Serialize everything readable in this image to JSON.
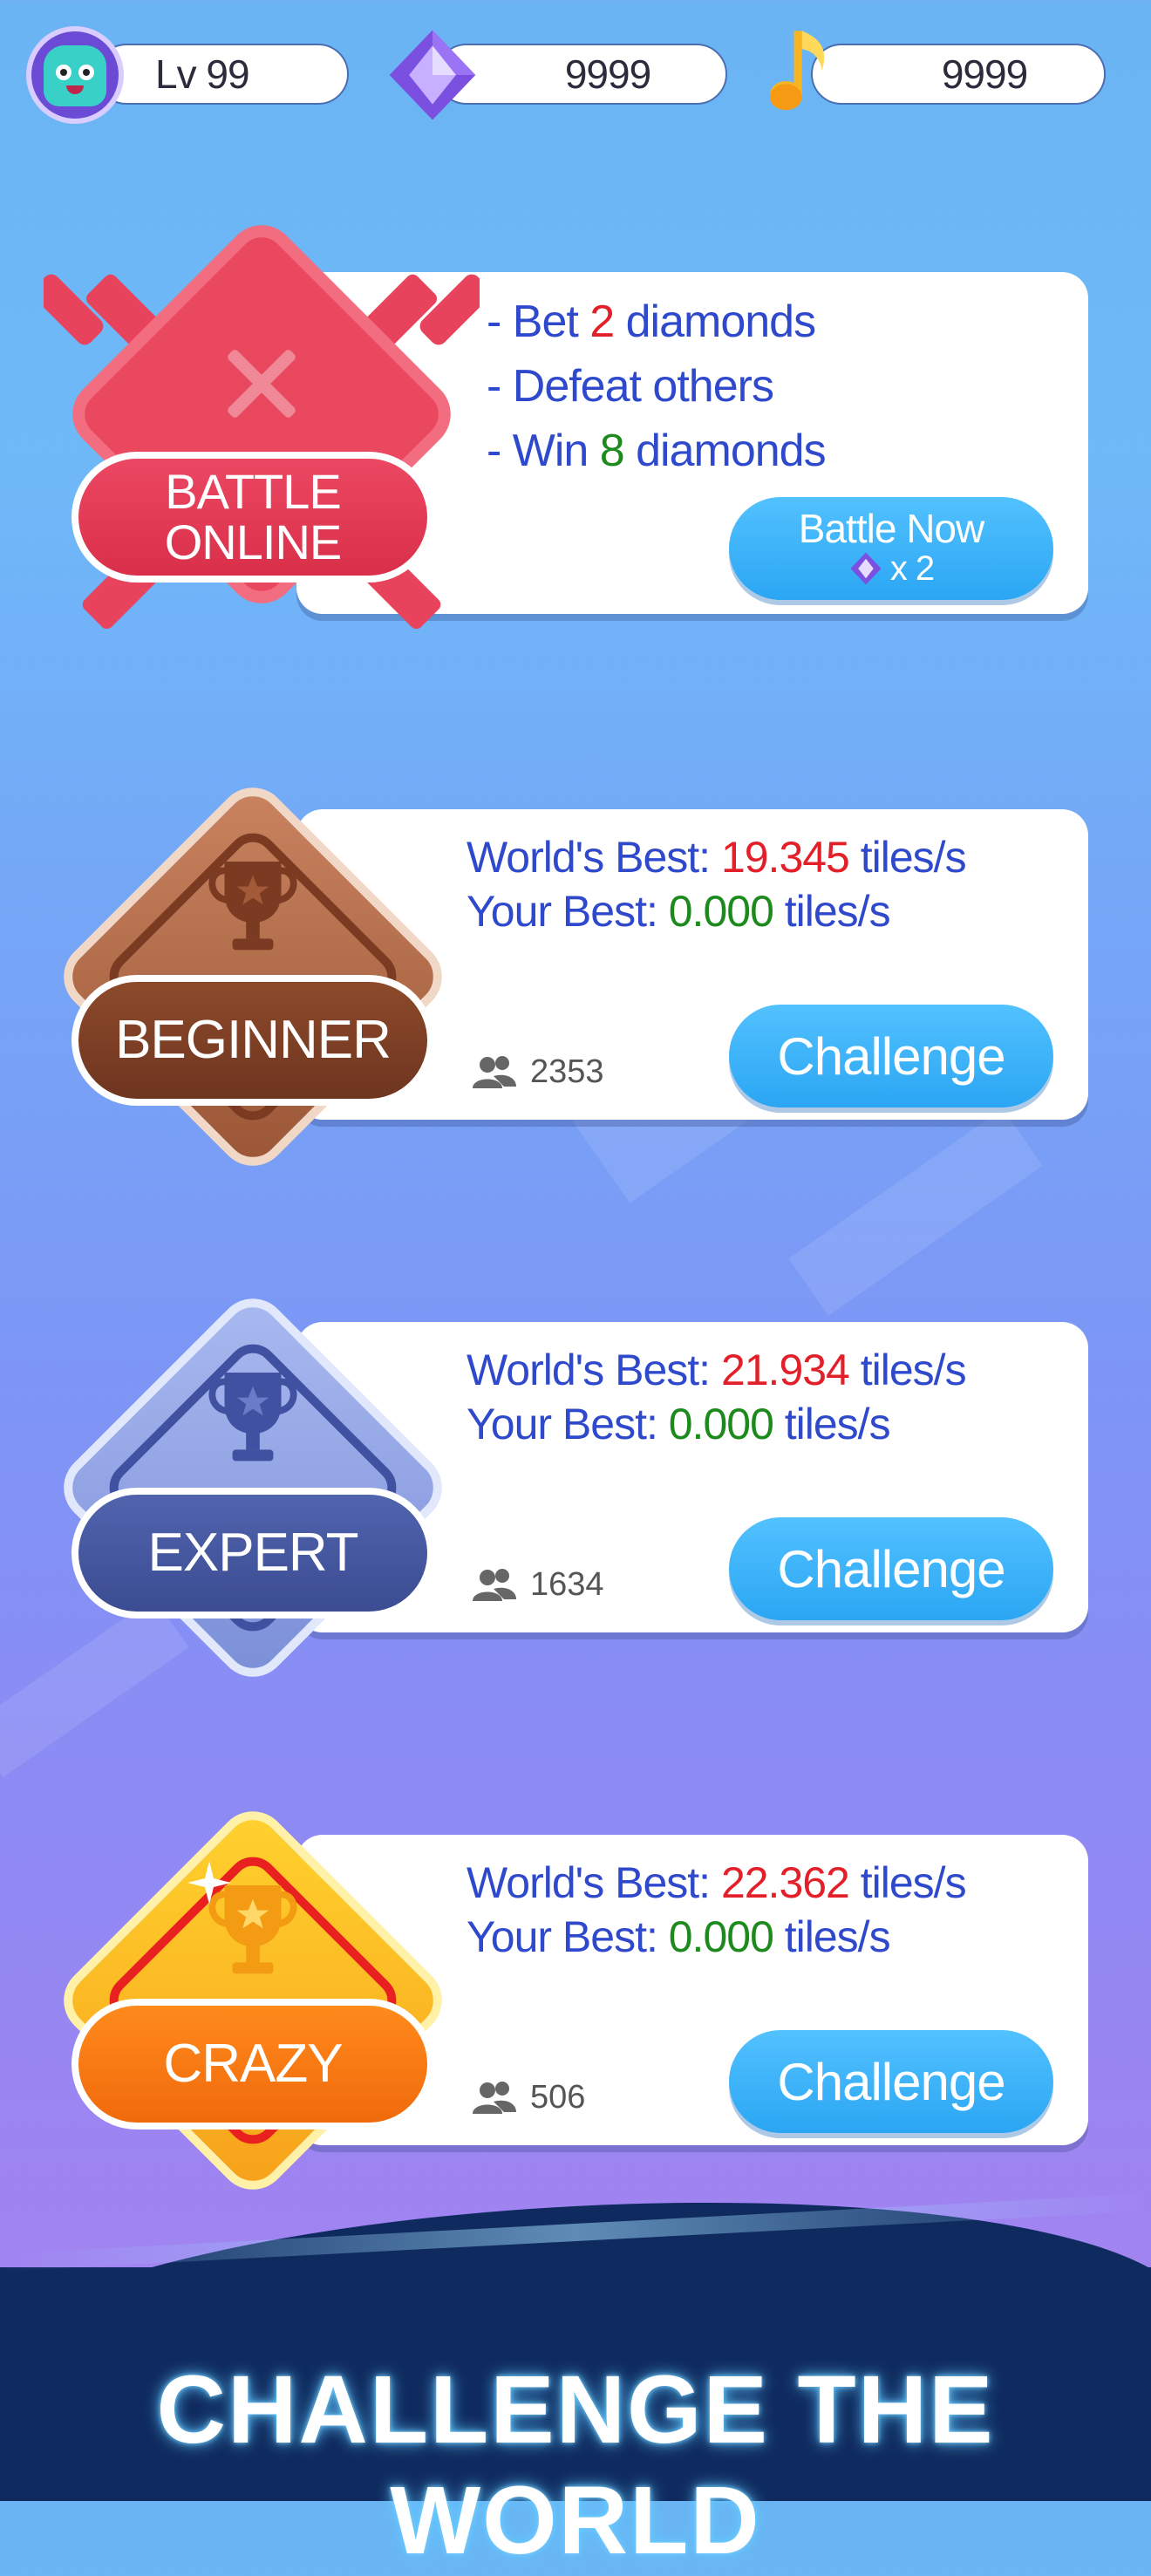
{
  "top_bar": {
    "level": "Lv 99",
    "diamonds": "9999",
    "notes": "9999"
  },
  "battle": {
    "badge_label": "BATTLE ONLINE",
    "line1_prefix": "- Bet ",
    "line1_value": "2",
    "line1_suffix": " diamonds",
    "line2": "- Defeat others",
    "line3_prefix": "- Win ",
    "line3_value": "8",
    "line3_suffix": " diamonds",
    "button_label": "Battle Now",
    "button_cost": "x 2"
  },
  "challenges": [
    {
      "badge_label": "BEGINNER",
      "world_best_label": "World's Best: ",
      "world_best_value": "19.345",
      "your_best_label": "Your Best: ",
      "your_best_value": "0.000",
      "unit": " tiles/s",
      "players": "2353",
      "button_label": "Challenge"
    },
    {
      "badge_label": "EXPERT",
      "world_best_label": "World's Best: ",
      "world_best_value": "21.934",
      "your_best_label": "Your Best: ",
      "your_best_value": "0.000",
      "unit": " tiles/s",
      "players": "1634",
      "button_label": "Challenge"
    },
    {
      "badge_label": "CRAZY",
      "world_best_label": "World's Best: ",
      "world_best_value": "22.362",
      "your_best_label": "Your Best: ",
      "your_best_value": "0.000",
      "unit": " tiles/s",
      "players": "506",
      "button_label": "Challenge"
    }
  ],
  "footer": {
    "slogan": "CHALLENGE THE WORLD"
  },
  "icons": {
    "avatar": "monster-avatar-icon",
    "diamond": "diamond-icon",
    "note": "music-note-icon",
    "players": "players-icon",
    "trophy": "trophy-icon",
    "swords": "crossed-swords-icon"
  },
  "colors": {
    "card_text": "#2f49cc",
    "highlight_red": "#e3202a",
    "highlight_green": "#1d8a1d",
    "button_blue": "#2ba6f3",
    "battle_red": "#e8435c",
    "beginner_brown": "#8a4a2f",
    "expert_blue": "#4c5fa8",
    "crazy_orange": "#f08a12"
  }
}
